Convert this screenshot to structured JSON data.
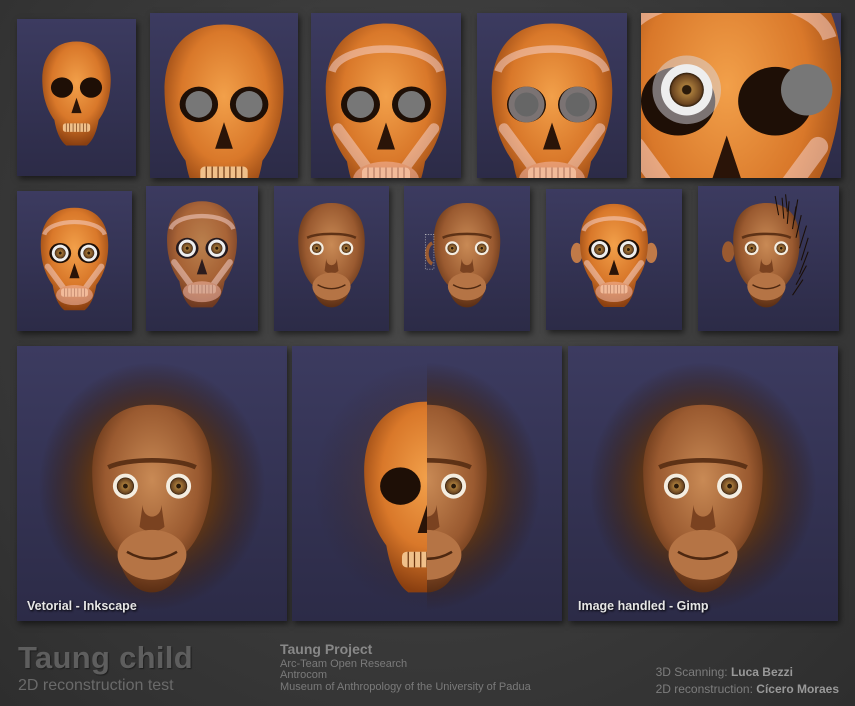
{
  "colors": {
    "panel_top": "#3c3b60",
    "panel_bottom": "#2c2b47",
    "skull": "#d9782a",
    "skin": "#9a5a30",
    "hair": "#4a2a14",
    "eye": "#7a5326"
  },
  "panels": {
    "row1": [
      {
        "stage": "skull"
      },
      {
        "stage": "skull-eyes"
      },
      {
        "stage": "skull-muscles"
      },
      {
        "stage": "skull-muscles-transparent"
      },
      {
        "stage": "eye-closeup"
      }
    ],
    "row2": [
      {
        "stage": "skull-with-eyes"
      },
      {
        "stage": "muscles-outline"
      },
      {
        "stage": "skin"
      },
      {
        "stage": "skin-ear-guides"
      },
      {
        "stage": "muscles-with-ears"
      },
      {
        "stage": "skin-hair-start"
      }
    ],
    "row3": [
      {
        "stage": "vector-result",
        "caption": "Vetorial - Inkscape"
      },
      {
        "stage": "half-skull-half-face",
        "caption": ""
      },
      {
        "stage": "raster-result",
        "caption": "Image handled - Gimp"
      }
    ]
  },
  "footer": {
    "title": "Taung child",
    "subtitle": "2D reconstruction test",
    "project": {
      "heading": "Taung Project",
      "lines": [
        "Arc-Team Open Research",
        "Antrocom",
        "Museum of Anthropology of the University of Padua"
      ]
    },
    "credits": {
      "scan_label": "3D Scanning:",
      "scan_name": "Luca Bezzi",
      "recon_label": "2D reconstruction:",
      "recon_name": "Cícero Moraes"
    }
  }
}
